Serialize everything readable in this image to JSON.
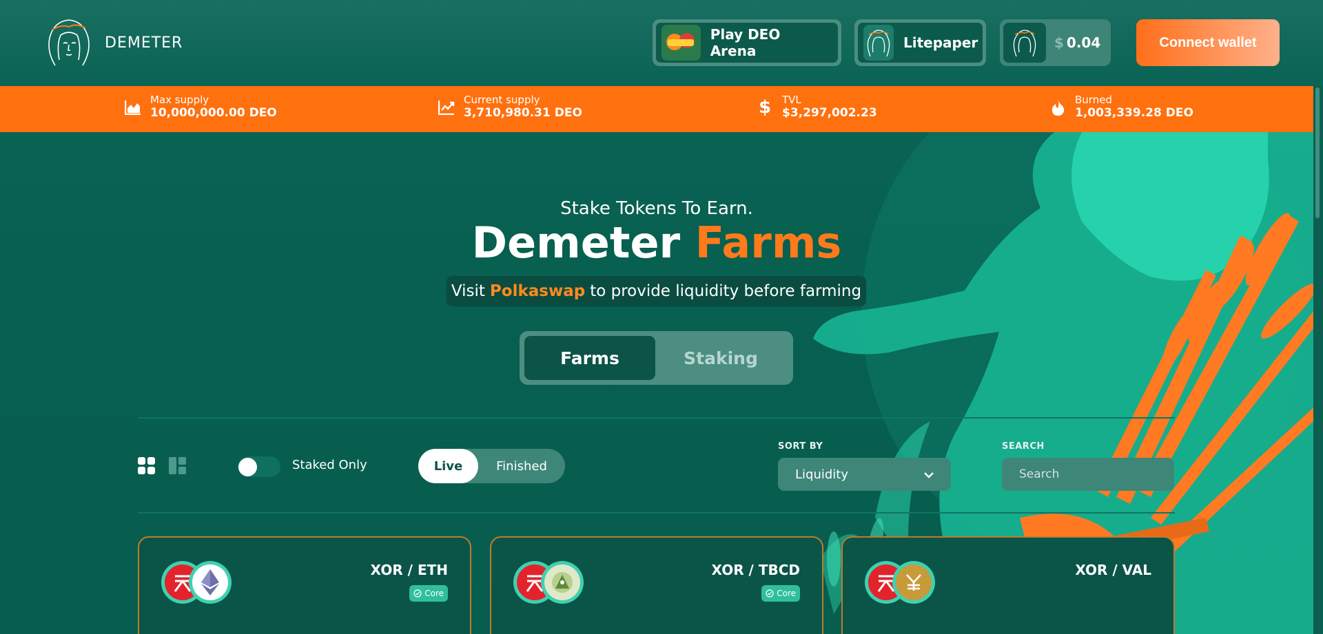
{
  "header": {
    "brand": "DEMETER",
    "play_label": "Play DEO Arena",
    "arena_icon": "deo-arena-icon",
    "litepaper_label": "Litepaper",
    "price_currency": "$",
    "price_value": "0.04",
    "connect_label": "Connect wallet"
  },
  "stats": [
    {
      "icon": "area-chart-icon",
      "label": "Max supply",
      "value": "10,000,000.00 DEO"
    },
    {
      "icon": "trend-chart-icon",
      "label": "Current supply",
      "value": "3,710,980.31 DEO"
    },
    {
      "icon": "dollar-icon",
      "label": "TVL",
      "value": "$3,297,002.23"
    },
    {
      "icon": "flame-icon",
      "label": "Burned",
      "value": "1,003,339.28 DEO"
    }
  ],
  "hero": {
    "subtitle": "Stake Tokens To Earn.",
    "title_main": "Demeter",
    "title_accent": "Farms",
    "visit_prefix": "Visit",
    "visit_link": "Polkaswap",
    "visit_suffix": "to provide liquidity before farming"
  },
  "tabs": {
    "farms": "Farms",
    "staking": "Staking",
    "active": "Farms"
  },
  "filters": {
    "staked_only_label": "Staked Only",
    "live_label": "Live",
    "finished_label": "Finished",
    "sort_by_label": "SORT BY",
    "sort_value": "Liquidity",
    "search_label": "SEARCH",
    "search_placeholder": "Search"
  },
  "cards": [
    {
      "pair": "XOR / ETH",
      "badge": "Core",
      "token_a": "xor-icon",
      "token_b": "eth-icon"
    },
    {
      "pair": "XOR / TBCD",
      "badge": "Core",
      "token_a": "xor-icon",
      "token_b": "tbcd-icon"
    },
    {
      "pair": "XOR / VAL",
      "badge": "",
      "token_a": "xor-icon",
      "token_b": "val-icon"
    }
  ],
  "colors": {
    "background": "#075d4e",
    "accent": "#ff700f",
    "button_gradient_end": "#ffb08a"
  }
}
